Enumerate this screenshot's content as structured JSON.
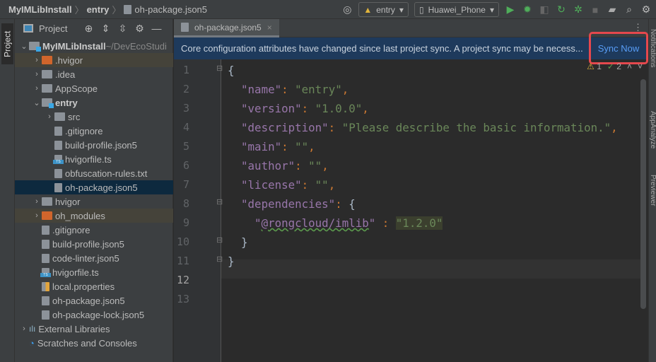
{
  "breadcrumb": {
    "project": "MyIMLibInstall",
    "module": "entry",
    "file": "oh-package.json5"
  },
  "toolbar": {
    "module_select": "entry",
    "device_select": "Huawei_Phone",
    "icons": [
      "locate-icon",
      "run-icon",
      "debug-icon",
      "profile-icon",
      "apply-changes-icon",
      "attach-debugger-icon",
      "stop-icon",
      "project-structure-icon",
      "search-icon",
      "settings-icon"
    ]
  },
  "left_strip": {
    "label": "Project"
  },
  "project_panel": {
    "title": "Project",
    "tree": [
      {
        "label": "MyIMLibInstall",
        "suffix": "~/DevEcoStudi",
        "level": 0,
        "type": "module",
        "expanded": true,
        "bold": true
      },
      {
        "label": ".hvigor",
        "level": 1,
        "type": "folder-excluded",
        "expanded": false
      },
      {
        "label": ".idea",
        "level": 1,
        "type": "folder",
        "expanded": false
      },
      {
        "label": "AppScope",
        "level": 1,
        "type": "folder",
        "expanded": false
      },
      {
        "label": "entry",
        "level": 1,
        "type": "module",
        "expanded": true,
        "bold": true
      },
      {
        "label": "src",
        "level": 2,
        "type": "folder",
        "expanded": false
      },
      {
        "label": ".gitignore",
        "level": 2,
        "type": "file"
      },
      {
        "label": "build-profile.json5",
        "level": 2,
        "type": "json"
      },
      {
        "label": "hvigorfile.ts",
        "level": 2,
        "type": "ts"
      },
      {
        "label": "obfuscation-rules.txt",
        "level": 2,
        "type": "txt"
      },
      {
        "label": "oh-package.json5",
        "level": 2,
        "type": "json",
        "selected": true
      },
      {
        "label": "hvigor",
        "level": 1,
        "type": "folder",
        "expanded": false
      },
      {
        "label": "oh_modules",
        "level": 1,
        "type": "folder-excluded",
        "expanded": false
      },
      {
        "label": ".gitignore",
        "level": 1,
        "type": "file"
      },
      {
        "label": "build-profile.json5",
        "level": 1,
        "type": "json"
      },
      {
        "label": "code-linter.json5",
        "level": 1,
        "type": "json"
      },
      {
        "label": "hvigorfile.ts",
        "level": 1,
        "type": "ts"
      },
      {
        "label": "local.properties",
        "level": 1,
        "type": "properties"
      },
      {
        "label": "oh-package.json5",
        "level": 1,
        "type": "json"
      },
      {
        "label": "oh-package-lock.json5",
        "level": 1,
        "type": "json"
      },
      {
        "label": "External Libraries",
        "level": 0,
        "type": "libraries",
        "expanded": false
      },
      {
        "label": "Scratches and Consoles",
        "level": 0,
        "type": "scratches"
      }
    ]
  },
  "editor": {
    "tab": "oh-package.json5",
    "banner": {
      "message": "Core configuration attributes have changed since last project sync. A project sync may be necess...",
      "action": "Sync Now"
    },
    "inspections": {
      "warnings": "1",
      "weak_warnings": "2"
    },
    "current_line": 12,
    "lines": [
      [
        {
          "t": "{",
          "k": "brace"
        }
      ],
      [
        {
          "t": "  "
        },
        {
          "t": "\"name\"",
          "k": "key"
        },
        {
          "t": ": ",
          "k": "punc"
        },
        {
          "t": "\"entry\"",
          "k": "str"
        },
        {
          "t": ",",
          "k": "punc"
        }
      ],
      [
        {
          "t": "  "
        },
        {
          "t": "\"version\"",
          "k": "key"
        },
        {
          "t": ": ",
          "k": "punc"
        },
        {
          "t": "\"1.0.0\"",
          "k": "str"
        },
        {
          "t": ",",
          "k": "punc"
        }
      ],
      [
        {
          "t": "  "
        },
        {
          "t": "\"description\"",
          "k": "key"
        },
        {
          "t": ": ",
          "k": "punc"
        },
        {
          "t": "\"Please describe the basic information.\"",
          "k": "str"
        },
        {
          "t": ",",
          "k": "punc"
        }
      ],
      [
        {
          "t": "  "
        },
        {
          "t": "\"main\"",
          "k": "key"
        },
        {
          "t": ": ",
          "k": "punc"
        },
        {
          "t": "\"\"",
          "k": "str"
        },
        {
          "t": ",",
          "k": "punc"
        }
      ],
      [
        {
          "t": "  "
        },
        {
          "t": "\"author\"",
          "k": "key"
        },
        {
          "t": ": ",
          "k": "punc"
        },
        {
          "t": "\"\"",
          "k": "str"
        },
        {
          "t": ",",
          "k": "punc"
        }
      ],
      [
        {
          "t": "  "
        },
        {
          "t": "\"license\"",
          "k": "key"
        },
        {
          "t": ": ",
          "k": "punc"
        },
        {
          "t": "\"\"",
          "k": "str"
        },
        {
          "t": ",",
          "k": "punc"
        }
      ],
      [
        {
          "t": "  "
        },
        {
          "t": "\"dependencies\"",
          "k": "key"
        },
        {
          "t": ": ",
          "k": "punc"
        },
        {
          "t": "{",
          "k": "brace"
        }
      ],
      [
        {
          "t": "    "
        },
        {
          "t": "\"",
          "k": "key"
        },
        {
          "t": "@rongcloud/imlib",
          "k": "key squig"
        },
        {
          "t": "\"",
          "k": "key"
        },
        {
          "t": " : ",
          "k": "punc"
        },
        {
          "t": "\"1.2.0\"",
          "k": "hl"
        }
      ],
      [
        {
          "t": "  "
        },
        {
          "t": "}",
          "k": "brace"
        }
      ],
      [
        {
          "t": "}",
          "k": "brace"
        }
      ],
      [],
      []
    ]
  },
  "right_strip": [
    "Notifications",
    "AppAnalyze",
    "Previewer"
  ]
}
